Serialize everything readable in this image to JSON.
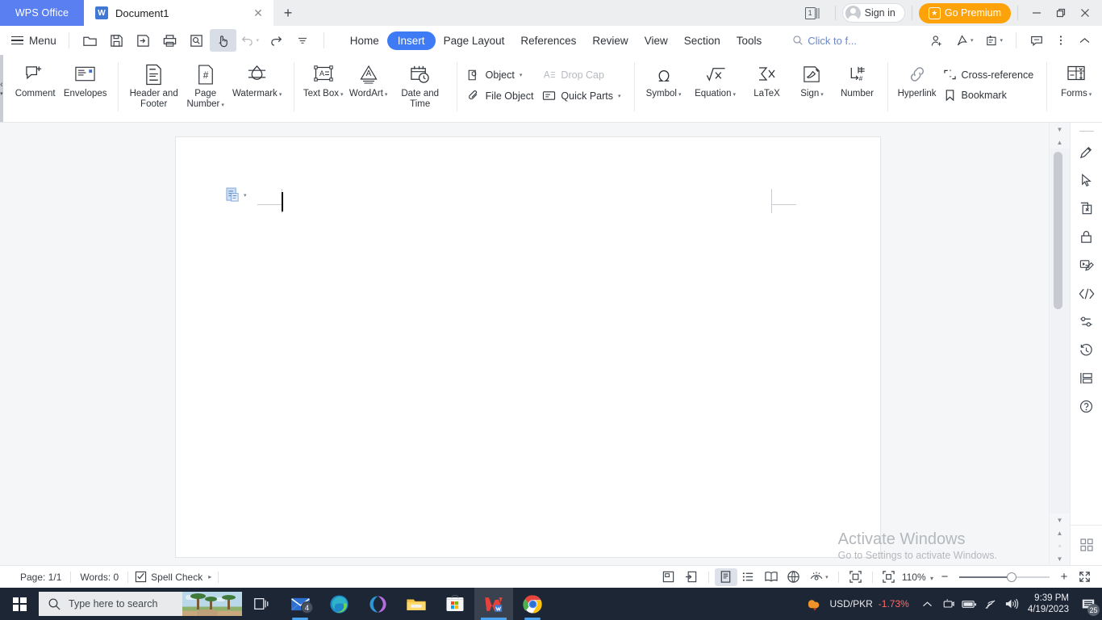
{
  "titlebar": {
    "brand": "WPS Office",
    "tab": {
      "label": "Document1",
      "icon": "wps-writer-icon",
      "close": "close-icon"
    },
    "new_tab": "new-tab-icon",
    "page_count_badge": "1",
    "sign_in": "Sign in",
    "go_premium": "Go Premium",
    "window_minimize": "minimize-icon",
    "window_restore": "restore-icon",
    "window_close": "close-icon"
  },
  "menurow": {
    "menu_label": "Menu",
    "quick_access": [
      {
        "name": "open-icon",
        "label": "Open",
        "state": "normal"
      },
      {
        "name": "save-icon",
        "label": "Save",
        "state": "normal"
      },
      {
        "name": "save-as-icon",
        "label": "Save As",
        "state": "normal"
      },
      {
        "name": "print-icon",
        "label": "Print",
        "state": "normal"
      },
      {
        "name": "print-preview-icon",
        "label": "Print Preview",
        "state": "normal"
      },
      {
        "name": "select-tool-icon",
        "label": "Select Tool",
        "state": "active"
      },
      {
        "name": "undo-icon",
        "label": "Undo",
        "state": "disabled"
      },
      {
        "name": "redo-icon",
        "label": "Redo",
        "state": "normal"
      },
      {
        "name": "customize-qat-icon",
        "label": "Customize Quick Access Toolbar",
        "state": "normal"
      }
    ],
    "tabs": [
      {
        "label": "Home",
        "active": false
      },
      {
        "label": "Insert",
        "active": true
      },
      {
        "label": "Page Layout",
        "active": false
      },
      {
        "label": "References",
        "active": false
      },
      {
        "label": "Review",
        "active": false
      },
      {
        "label": "View",
        "active": false
      },
      {
        "label": "Section",
        "active": false
      },
      {
        "label": "Tools",
        "active": false
      }
    ],
    "search_placeholder": "Click to f...",
    "right_tools": [
      {
        "name": "invite-collaborator-icon",
        "label": "Invite"
      },
      {
        "name": "share-icon",
        "label": "Share"
      },
      {
        "name": "export-pdf-icon",
        "label": "Export"
      },
      {
        "name": "comment-icon",
        "label": "Comments"
      },
      {
        "name": "more-options-icon",
        "label": "More"
      },
      {
        "name": "collapse-ribbon-icon",
        "label": "Collapse Ribbon"
      }
    ]
  },
  "ribbon": {
    "groups": [
      {
        "name": "comments-group",
        "buttons": [
          {
            "label": "Comment",
            "icon": "comment-add-icon",
            "dropdown": false,
            "size": "big"
          },
          {
            "label": "Envelopes",
            "icon": "envelopes-icon",
            "dropdown": false,
            "size": "big"
          }
        ]
      },
      {
        "name": "header-footer-group",
        "buttons": [
          {
            "label": "Header and Footer",
            "icon": "header-footer-icon",
            "dropdown": false,
            "size": "big"
          },
          {
            "label": "Page Number",
            "icon": "page-number-icon",
            "dropdown": true,
            "size": "big"
          },
          {
            "label": "Watermark",
            "icon": "watermark-icon",
            "dropdown": true,
            "size": "big"
          }
        ]
      },
      {
        "name": "text-group",
        "buttons": [
          {
            "label": "Text Box",
            "icon": "text-box-icon",
            "dropdown": true,
            "size": "big"
          },
          {
            "label": "WordArt",
            "icon": "wordart-icon",
            "dropdown": true,
            "size": "big"
          },
          {
            "label": "Date and Time",
            "icon": "date-time-icon",
            "dropdown": false,
            "size": "big"
          }
        ]
      },
      {
        "name": "object-group",
        "buttons": [
          {
            "label": "Object",
            "icon": "object-icon",
            "dropdown": true,
            "size": "small",
            "disabled": false
          },
          {
            "label": "Drop Cap",
            "icon": "drop-cap-icon",
            "dropdown": false,
            "size": "small",
            "disabled": true
          },
          {
            "label": "File Object",
            "icon": "file-object-icon",
            "dropdown": false,
            "size": "small",
            "disabled": false
          },
          {
            "label": "Quick Parts",
            "icon": "quick-parts-icon",
            "dropdown": true,
            "size": "small",
            "disabled": false
          }
        ]
      },
      {
        "name": "symbols-group",
        "buttons": [
          {
            "label": "Symbol",
            "icon": "omega-symbol-icon",
            "dropdown": true,
            "size": "big"
          },
          {
            "label": "Equation",
            "icon": "equation-icon",
            "dropdown": true,
            "size": "big"
          },
          {
            "label": "LaTeX",
            "icon": "latex-icon",
            "dropdown": false,
            "size": "big"
          },
          {
            "label": "Sign",
            "icon": "signature-icon",
            "dropdown": true,
            "size": "big"
          },
          {
            "label": "Number",
            "icon": "number-icon",
            "dropdown": false,
            "size": "big"
          }
        ]
      },
      {
        "name": "links-group",
        "buttons": [
          {
            "label": "Hyperlink",
            "icon": "hyperlink-icon",
            "dropdown": false,
            "size": "big"
          },
          {
            "label": "Cross-reference",
            "icon": "cross-reference-icon",
            "dropdown": false,
            "size": "small",
            "disabled": false
          },
          {
            "label": "Bookmark",
            "icon": "bookmark-icon",
            "dropdown": false,
            "size": "small",
            "disabled": false
          }
        ]
      },
      {
        "name": "forms-group",
        "buttons": [
          {
            "label": "Forms",
            "icon": "forms-icon",
            "dropdown": true,
            "size": "big"
          }
        ]
      }
    ]
  },
  "document": {
    "paste_options_icon": "paste-options-icon",
    "caret": "text-caret"
  },
  "rail": {
    "items": [
      {
        "name": "highlighter-pen-icon",
        "label": "Pen"
      },
      {
        "name": "selection-cursor-icon",
        "label": "Select"
      },
      {
        "name": "delete-page-icon",
        "label": "Delete Page"
      },
      {
        "name": "document-encryption-icon",
        "label": "Encrypt"
      },
      {
        "name": "edit-on-pc-icon",
        "label": "Edit"
      },
      {
        "name": "code-snippet-icon",
        "label": "Code"
      },
      {
        "name": "settings-sliders-icon",
        "label": "Settings"
      },
      {
        "name": "history-icon",
        "label": "History"
      },
      {
        "name": "outline-panel-icon",
        "label": "Outline"
      },
      {
        "name": "help-icon",
        "label": "Help"
      }
    ],
    "bottom": {
      "name": "app-grid-icon",
      "label": "Apps"
    }
  },
  "watermark": {
    "line1": "Activate Windows",
    "line2": "Go to Settings to activate Windows."
  },
  "statusbar": {
    "page": "Page: 1/1",
    "words": "Words: 0",
    "spell_check": "Spell Check",
    "view_buttons": [
      {
        "name": "page-layout-view-icon",
        "label": "Page Layout View",
        "active": true
      },
      {
        "name": "outline-view-icon",
        "label": "Outline View",
        "active": false
      },
      {
        "name": "reading-layout-icon",
        "label": "Reading Layout",
        "active": false
      },
      {
        "name": "web-layout-icon",
        "label": "Web Layout",
        "active": false
      },
      {
        "name": "eye-protection-icon",
        "label": "Eye Protection Mode",
        "active": false
      }
    ],
    "full_screen": "full-screen-icon",
    "fit_page": "fit-page-icon",
    "zoom_level": "110%",
    "zoom_out": "−",
    "zoom_in": "+",
    "expand_icon": "expand-arrows-icon",
    "left_icons": [
      {
        "name": "revision-mark-icon",
        "label": "Revision"
      },
      {
        "name": "insert-cursor-icon",
        "label": "Cursor"
      }
    ]
  },
  "taskbar": {
    "start": "windows-start-icon",
    "search_placeholder": "Type here to search",
    "task_view": "task-view-icon",
    "apps": [
      {
        "name": "mail-icon",
        "label": "Mail",
        "badge": "4",
        "active": false,
        "open": true
      },
      {
        "name": "edge-icon",
        "label": "Microsoft Edge",
        "active": false,
        "open": false
      },
      {
        "name": "office-icon",
        "label": "Office",
        "active": false,
        "open": false
      },
      {
        "name": "file-explorer-icon",
        "label": "File Explorer",
        "active": false,
        "open": false
      },
      {
        "name": "microsoft-store-icon",
        "label": "Microsoft Store",
        "active": false,
        "open": false
      },
      {
        "name": "wps-office-icon",
        "label": "WPS Office",
        "active": true,
        "open": false
      },
      {
        "name": "chrome-icon",
        "label": "Google Chrome",
        "active": false,
        "open": true
      }
    ],
    "tray": {
      "stock_symbol": "USD/PKR",
      "stock_change": "-1.73%",
      "show_hidden": "chevron-up-icon",
      "icons": [
        {
          "name": "onedrive-camera-icon",
          "label": "Camera"
        },
        {
          "name": "battery-icon",
          "label": "Battery"
        },
        {
          "name": "wifi-icon",
          "label": "Network"
        },
        {
          "name": "volume-icon",
          "label": "Volume"
        }
      ],
      "time": "9:39 PM",
      "date": "4/19/2023",
      "notification_count": "25"
    }
  }
}
